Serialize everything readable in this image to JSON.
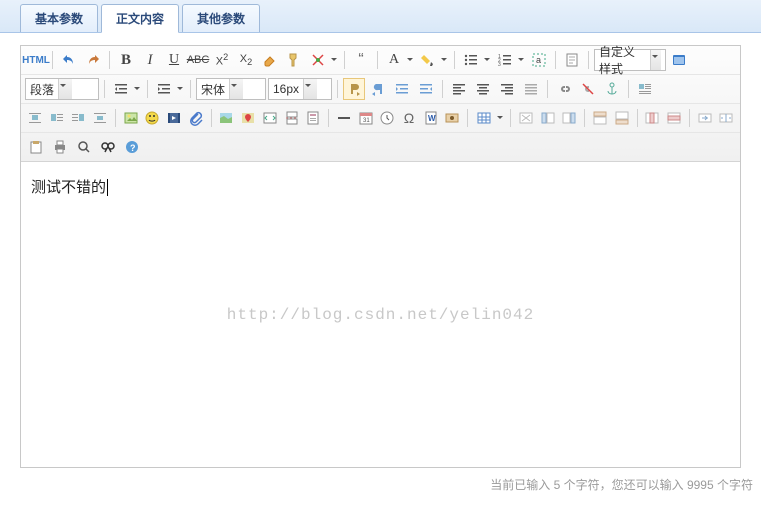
{
  "tabs": [
    {
      "label": "基本参数",
      "active": false
    },
    {
      "label": "正文内容",
      "active": true
    },
    {
      "label": "其他参数",
      "active": false
    }
  ],
  "toolbar": {
    "html": "HTML",
    "para_sel": "段落",
    "font_sel": "宋体",
    "size_sel": "16px",
    "style_sel": "自定义样式"
  },
  "content": {
    "text": "测试不错的",
    "watermark": "http://blog.csdn.net/yelin042"
  },
  "status": {
    "prefix": "当前已输入 ",
    "count": "5",
    "mid": " 个字符，您还可以输入 ",
    "remaining": "9995",
    "suffix": " 个字符"
  }
}
